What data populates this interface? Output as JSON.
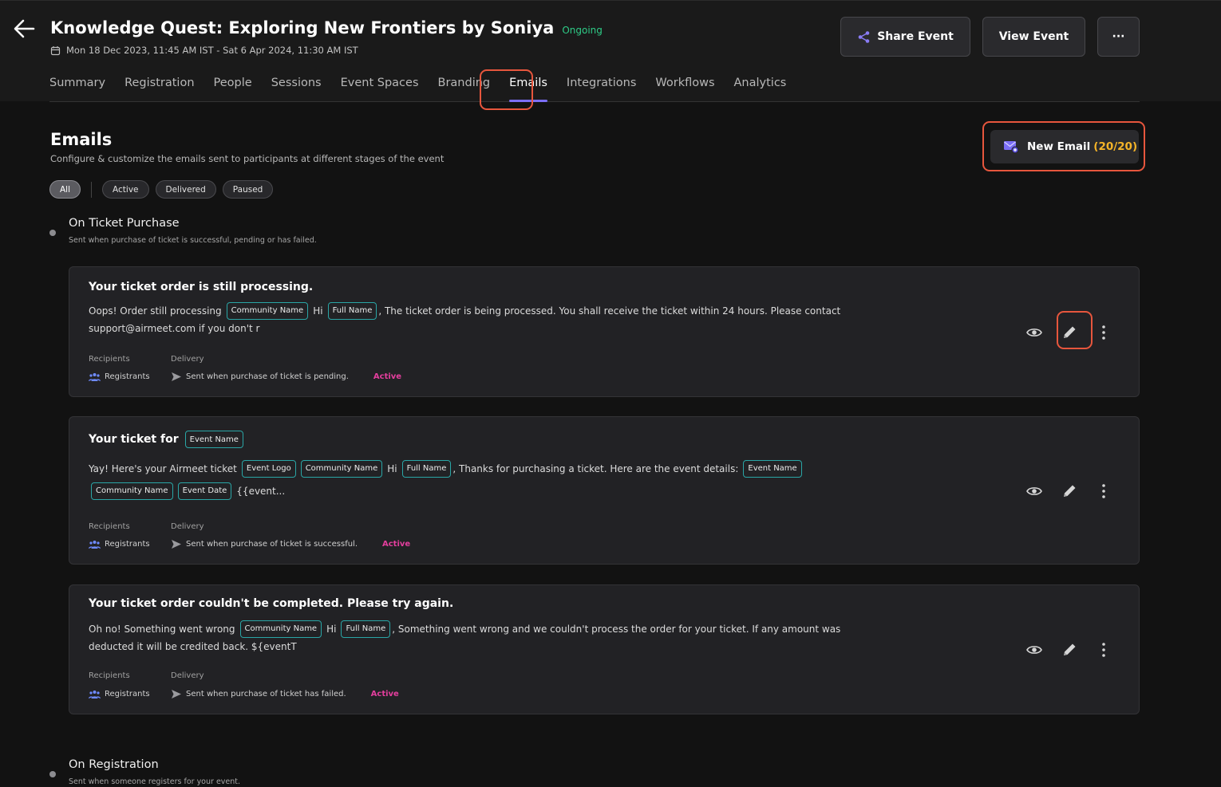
{
  "event": {
    "title": "Knowledge Quest: Exploring New Frontiers by Soniya",
    "status": "Ongoing",
    "date_range": "Mon 18 Dec 2023, 11:45 AM IST - Sat 6 Apr 2024, 11:30 AM IST"
  },
  "header_actions": {
    "share": "Share Event",
    "view": "View Event",
    "more": "···"
  },
  "tabs": [
    "Summary",
    "Registration",
    "People",
    "Sessions",
    "Event Spaces",
    "Branding",
    "Emails",
    "Integrations",
    "Workflows",
    "Analytics"
  ],
  "active_tab": "Emails",
  "page": {
    "title": "Emails",
    "description": "Configure & customize the emails sent to participants at different stages of the event",
    "new_email_label": "New Email",
    "new_email_count": "(20/20)"
  },
  "filters": [
    "All",
    "Active",
    "Delivered",
    "Paused"
  ],
  "meta_labels": {
    "recipients": "Recipients",
    "delivery": "Delivery"
  },
  "groups": [
    {
      "title": "On Ticket Purchase",
      "description": "Sent when purchase of ticket is successful, pending or has failed.",
      "emails": [
        {
          "title": "Your ticket order is still processing.",
          "body_line1": [
            "Oops! Order still processing",
            {
              "tag": "Community Name"
            },
            "Hi",
            {
              "tag": "Full Name"
            },
            ", The ticket order is being processed. You shall receive the ticket within 24 hours. Please contact"
          ],
          "body_line2": [
            "support@airmeet.com if you don't r"
          ],
          "recipients": "Registrants",
          "delivery": "Sent when purchase of ticket is pending.",
          "status": "Active"
        },
        {
          "title": "Your ticket for",
          "title_tag": "Event Name",
          "body_line1": [
            "Yay! Here's your Airmeet ticket",
            {
              "tag": "Event Logo"
            },
            {
              "tag": "Community Name"
            },
            "Hi",
            {
              "tag": "Full Name"
            },
            ", Thanks for purchasing a ticket. Here are the event details:",
            {
              "tag": "Event Name"
            }
          ],
          "body_line2": [
            {
              "tag": "Community Name"
            },
            {
              "tag": "Event Date"
            },
            "{{event..."
          ],
          "recipients": "Registrants",
          "delivery": "Sent when purchase of ticket is successful.",
          "status": "Active"
        },
        {
          "title": "Your ticket order couldn't be completed. Please try again.",
          "body_line1": [
            "Oh no! Something went wrong",
            {
              "tag": "Community Name"
            },
            "Hi",
            {
              "tag": "Full Name"
            },
            ", Something went wrong and we couldn't process the order for your ticket. If any amount was"
          ],
          "body_line2": [
            "deducted it will be credited back. ${eventT"
          ],
          "recipients": "Registrants",
          "delivery": "Sent when purchase of ticket has failed.",
          "status": "Active"
        }
      ]
    },
    {
      "title": "On Registration",
      "description": "Sent when someone registers for your event."
    }
  ],
  "colors": {
    "accent": "#7b6ef6",
    "status_ongoing": "#2ecc87",
    "status_active": "#e33e9d",
    "tag_border": "#2aa6a6",
    "highlight": "#e7563d",
    "count": "#f5b428"
  },
  "icons": {
    "back": "arrow-left-icon",
    "calendar": "calendar-icon",
    "share": "share-icon",
    "mail": "mail-plus-icon",
    "recipients": "users-icon",
    "delivery": "send-icon",
    "preview": "eye-icon",
    "edit": "pencil-icon",
    "menu": "kebab-icon"
  }
}
